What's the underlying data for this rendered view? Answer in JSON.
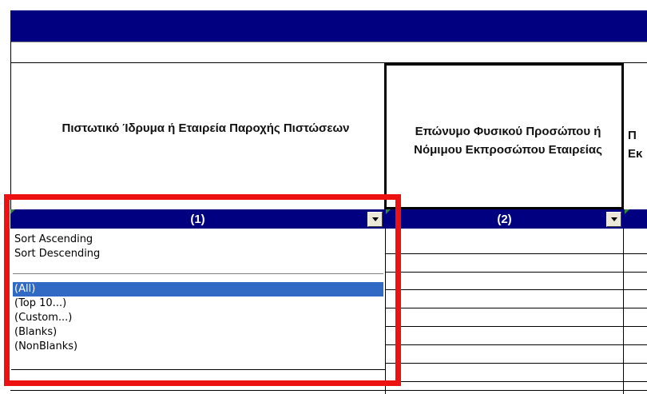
{
  "colors": {
    "title_bar": "#000080",
    "column_bar": "#000080",
    "highlight_border": "#ee1111",
    "selection": "#316ac5"
  },
  "columns": [
    {
      "header": "Πιστωτικό Ίδρυμα ή Εταιρεία Παροχής Πιστώσεων",
      "number": "(1)"
    },
    {
      "header": "Επώνυμο Φυσικού Προσώπου ή Νόμιμου Εκπροσώπου Εταιρείας",
      "number": "(2)"
    },
    {
      "header": "Π\nΕκ"
    }
  ],
  "filter_menu": {
    "sort_items": [
      "Sort Ascending",
      "Sort Descending"
    ],
    "filter_items": [
      "(All)",
      "(Top 10...)",
      "(Custom...)",
      "(Blanks)",
      "(NonBlanks)"
    ],
    "selected": "(All)"
  },
  "icons": [
    "dropdown-arrow-icon",
    "cell-comment-marker-icon"
  ]
}
